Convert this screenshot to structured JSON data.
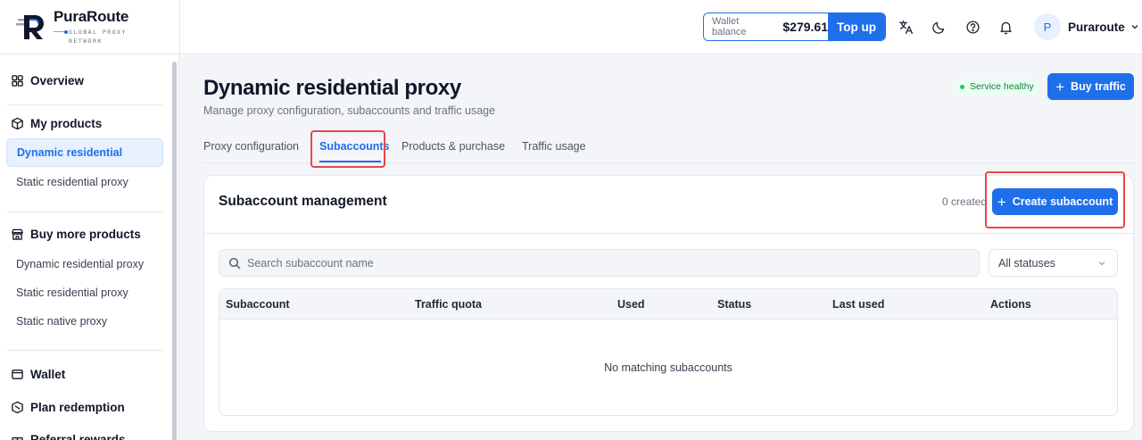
{
  "brand": {
    "name": "PuraRoute",
    "tagline": "GLOBAL PROXY NETWORK"
  },
  "header": {
    "wallet_label": "Wallet balance",
    "wallet_amount": "$279.61",
    "topup_label": "Top up",
    "user_initial": "P",
    "user_name": "Puraroute",
    "icons": [
      "translate-icon",
      "moon-icon",
      "help-icon",
      "bell-icon"
    ]
  },
  "sidebar": {
    "overview": "Overview",
    "my_products": "My products",
    "my_products_items": [
      "Dynamic residential",
      "Static residential proxy"
    ],
    "buy_more": "Buy more products",
    "buy_more_items": [
      "Dynamic residential proxy",
      "Static residential proxy",
      "Static native proxy"
    ],
    "wallet": "Wallet",
    "plan_redemption": "Plan redemption",
    "referral": "Referral rewards"
  },
  "page": {
    "title": "Dynamic residential proxy",
    "subtitle": "Manage proxy configuration, subaccounts and traffic usage",
    "status": "Service healthy",
    "buy_label": "Buy traffic"
  },
  "tabs": [
    "Proxy configuration",
    "Subaccounts",
    "Products & purchase",
    "Traffic usage"
  ],
  "active_tab": "Subaccounts",
  "card": {
    "title": "Subaccount management",
    "count_text": "0 created",
    "create_label": "Create subaccount"
  },
  "filters": {
    "search_placeholder": "Search subaccount name",
    "status_value": "All statuses"
  },
  "table": {
    "columns": [
      "Subaccount",
      "Traffic quota",
      "Used",
      "Status",
      "Last used",
      "Actions"
    ],
    "empty_text": "No matching subaccounts"
  },
  "colors": {
    "accent": "#1f6feb",
    "highlight": "#e5484d",
    "healthy": "#15803d"
  }
}
